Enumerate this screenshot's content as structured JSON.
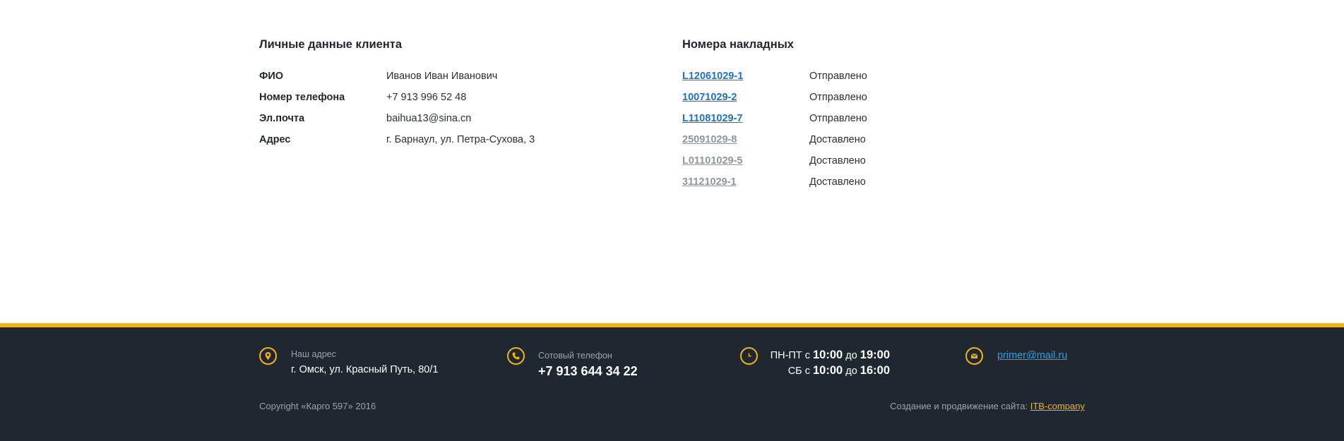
{
  "client": {
    "title": "Личные данные клиента",
    "fields": [
      {
        "label": "ФИО",
        "value": "Иванов Иван Иванович"
      },
      {
        "label": "Номер телефона",
        "value": "+7 913 996 52 48"
      },
      {
        "label": "Эл.почта",
        "value": "baihua13@sina.cn"
      },
      {
        "label": "Адрес",
        "value": "г. Барнаул, ул. Петра-Сухова, 3"
      }
    ]
  },
  "invoices": {
    "title": "Номера накладных",
    "items": [
      {
        "number": "L12061029-1",
        "status": "Отправлено"
      },
      {
        "number": "10071029-2",
        "status": "Отправлено"
      },
      {
        "number": "L11081029-7",
        "status": "Отправлено"
      },
      {
        "number": "25091029-8",
        "status": "Доставлено"
      },
      {
        "number": "L01101029-5",
        "status": "Доставлено"
      },
      {
        "number": "31121029-1",
        "status": "Доставлено"
      }
    ]
  },
  "footer": {
    "address_label": "Наш адрес",
    "address_value": "г. Омск, ул. Красный Путь, 80/1",
    "phone_label": "Сотовый телефон",
    "phone_value": "+7 913 644 34 22",
    "hours": {
      "weekday_prefix": "ПН-ПТ с",
      "weekday_from": "10:00",
      "weekday_mid": "до",
      "weekday_to": "19:00",
      "sat_prefix": "СБ с",
      "sat_from": "10:00",
      "sat_mid": "до",
      "sat_to": "16:00"
    },
    "email": "primer@mail.ru",
    "copyright": "Copyright «Карго 597» 2016",
    "credit_text": "Создание и продвижение сайта:",
    "credit_link": "ITB-company",
    "icons": [
      "map-pin-icon",
      "phone-icon",
      "clock-icon",
      "mail-icon"
    ]
  },
  "colors": {
    "accent": "#f4b10f",
    "footer_bg": "#1f2830",
    "link_sent": "#1a73c8",
    "link_delivered": "#8a96a3",
    "email_link": "#2aa0e8"
  }
}
